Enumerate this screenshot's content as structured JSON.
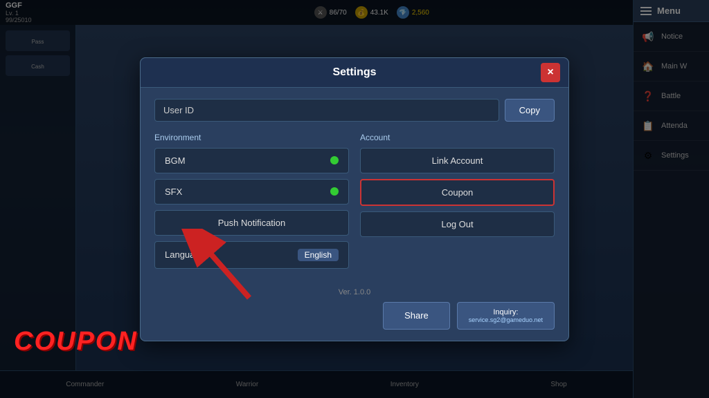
{
  "hud": {
    "player_name": "GGF",
    "player_level": "Lv. 1",
    "player_exp": "99/25010",
    "stat1_icon": "⚔",
    "stat1_value": "86/70",
    "stat2_icon": "💰",
    "stat2_value": "43.1K",
    "currency": "2,560"
  },
  "sidebar": {
    "menu_label": "Menu",
    "items": [
      {
        "label": "Notice",
        "icon": "📢"
      },
      {
        "label": "Main W",
        "icon": "🏠"
      },
      {
        "label": "Battle",
        "icon": "❓"
      },
      {
        "label": "Attenda",
        "icon": "📋"
      },
      {
        "label": "Settings",
        "icon": "⚙"
      }
    ]
  },
  "modal": {
    "title": "Settings",
    "close_label": "×",
    "user_id_placeholder": "User ID",
    "copy_label": "Copy",
    "environment_label": "Environment",
    "account_label": "Account",
    "bgm_label": "BGM",
    "sfx_label": "SFX",
    "push_notification_label": "Push Notification",
    "language_label": "Language",
    "language_value": "English",
    "link_account_label": "Link Account",
    "coupon_label": "Coupon",
    "logout_label": "Log Out",
    "share_label": "Share",
    "inquiry_label": "Inquiry:",
    "inquiry_email": "service.sg2@gameduo.net",
    "version": "Ver. 1.0.0"
  },
  "bottom_nav": {
    "items": [
      "Commander",
      "Warrior",
      "Inventory",
      "Shop"
    ]
  },
  "coupon_watermark": "COUPON",
  "left_panel": {
    "items": [
      {
        "label": "Pass"
      },
      {
        "label": "Cash"
      }
    ]
  }
}
